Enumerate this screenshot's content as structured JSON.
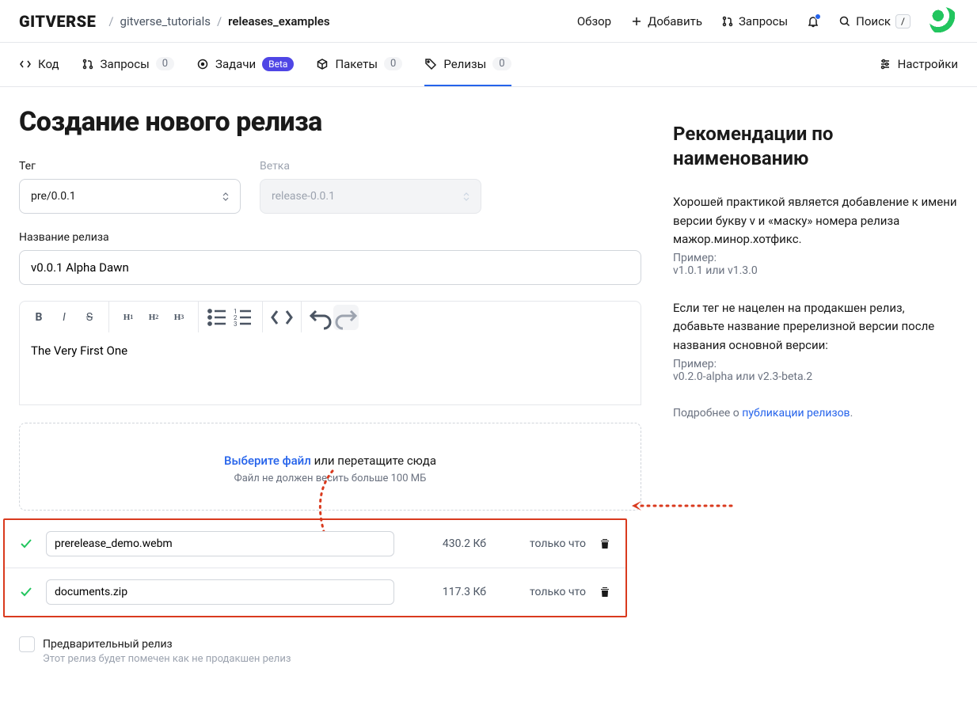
{
  "header": {
    "logo": "GITVERSE",
    "breadcrumb": {
      "owner": "gitverse_tutorials",
      "repo": "releases_examples"
    },
    "nav": {
      "overview": "Обзор",
      "add": "Добавить",
      "requests": "Запросы",
      "search": "Поиск",
      "search_kbd": "/"
    }
  },
  "tabs": {
    "code": "Код",
    "requests": "Запросы",
    "requests_count": "0",
    "tasks": "Задачи",
    "tasks_badge": "Beta",
    "packages": "Пакеты",
    "packages_count": "0",
    "releases": "Релизы",
    "releases_count": "0",
    "settings": "Настройки"
  },
  "page": {
    "title": "Создание нового релиза",
    "tag_label": "Тег",
    "tag_value": "pre/0.0.1",
    "branch_label": "Ветка",
    "branch_value": "release-0.0.1",
    "name_label": "Название релиза",
    "name_value": "v0.0.1 Alpha Dawn",
    "desc_value": "The Very First One",
    "dropzone": {
      "choose": "Выберите файл",
      "or": "или перетащите сюда",
      "hint": "Файл не должен весить больше 100 МБ"
    },
    "files": [
      {
        "name": "prerelease_demo.webm",
        "size": "430.2 Кб",
        "time": "только что"
      },
      {
        "name": "documents.zip",
        "size": "117.3 Кб",
        "time": "только что"
      }
    ],
    "prerelease": {
      "label": "Предварительный релиз",
      "sub": "Этот релиз будет помечен как не продакшен релиз"
    }
  },
  "sidebar": {
    "title": "Рекомендации по наименованию",
    "p1": "Хорошей практикой является добавление к имени версии букву v и «маску» номера релиза мажор.минор.хотфикс.",
    "p1_sub_label": "Пример:",
    "p1_sub": "v1.0.1 или v1.3.0",
    "p2": "Если тег не нацелен на продакшен релиз, добавьте название пререлизной версии после названия основной версии:",
    "p2_sub_label": "Пример:",
    "p2_sub": "v0.2.0-alpha или v2.3-beta.2",
    "more_prefix": "Подробнее о ",
    "more_link": "публикации релизов",
    "more_suffix": "."
  },
  "annotation_color": "#d93a1e"
}
